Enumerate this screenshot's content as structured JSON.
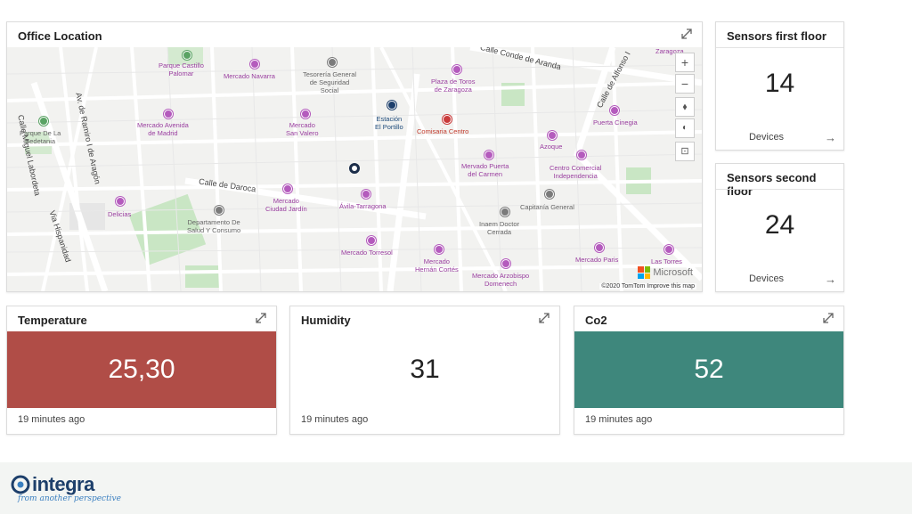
{
  "map_card": {
    "title": "Office Location",
    "attribution": "©2020 TomTom  Improve this map",
    "provider": "Microsoft",
    "labels": {
      "parque_castillo": "Parque Castillo\nPalomar",
      "mercado_navarra": "Mercado Navarra",
      "tesoreria": "Tesorería General\nde Seguridad\nSocial",
      "plaza_toros": "Plaza de Toros\nde Zaragoza",
      "estacion": "Estación\nEl Portillo",
      "comisaria": "Comisaria Centro",
      "mercado_avenida": "Mercado Avenida\nde Madrid",
      "mercado_san_valero": "Mercado\nSan Valero",
      "parque_sedetania": "Parque De La\nSedetania",
      "puerta_cinegia": "Puerta Cinegia",
      "azoque": "Azoque",
      "mervado_puerta": "Mervado Puerta\ndel Carmen",
      "centro_comercial": "Centro Comercial\nIndependencia",
      "capitania": "Capitanía General",
      "mercado_ciudad_jardin": "Mercado\nCiudad Jardín",
      "avila_tarragona": "Ávila-Tarragona",
      "delicias": "Delicias",
      "departamento": "Departamento De\nSalud Y Consumo",
      "inaem": "Inaem Doctor\nCerrada",
      "mercado_torresol": "Mercado Torresol",
      "mercado_hernan": "Mercado\nHernán Cortés",
      "mercado_arzobispo": "Mercado Arzobispo\nDomenech",
      "mercado_paris": "Mercado Paris",
      "las_torres": "Las Torres",
      "zaragoza": "Zaragoza"
    },
    "streets": {
      "conde_aranda": "Calle Conde de Aranda",
      "miguel_laborda": "Calle Miguel Labordeta",
      "ramiro": "Av. de Ramiro I de Aragón",
      "daroca": "Calle de Daroca",
      "hispanidad": "Via Hispanidad",
      "alfonso": "Calle de Alfonso I"
    }
  },
  "sensors": [
    {
      "title": "Sensors first floor",
      "value": "14",
      "sub": "Devices"
    },
    {
      "title": "Sensors second floor",
      "value": "24",
      "sub": "Devices"
    }
  ],
  "metrics": [
    {
      "title": "Temperature",
      "value": "25,30",
      "time": "19 minutes ago",
      "bg": "#b04d47",
      "fg": "#ffffff"
    },
    {
      "title": "Humidity",
      "value": "31",
      "time": "19 minutes ago",
      "bg": "#ffffff",
      "fg": "#222222"
    },
    {
      "title": "Co2",
      "value": "52",
      "time": "19 minutes ago",
      "bg": "#3e877c",
      "fg": "#ffffff"
    }
  ],
  "footer": {
    "logo_text": "integra",
    "tagline": "from another perspective"
  }
}
